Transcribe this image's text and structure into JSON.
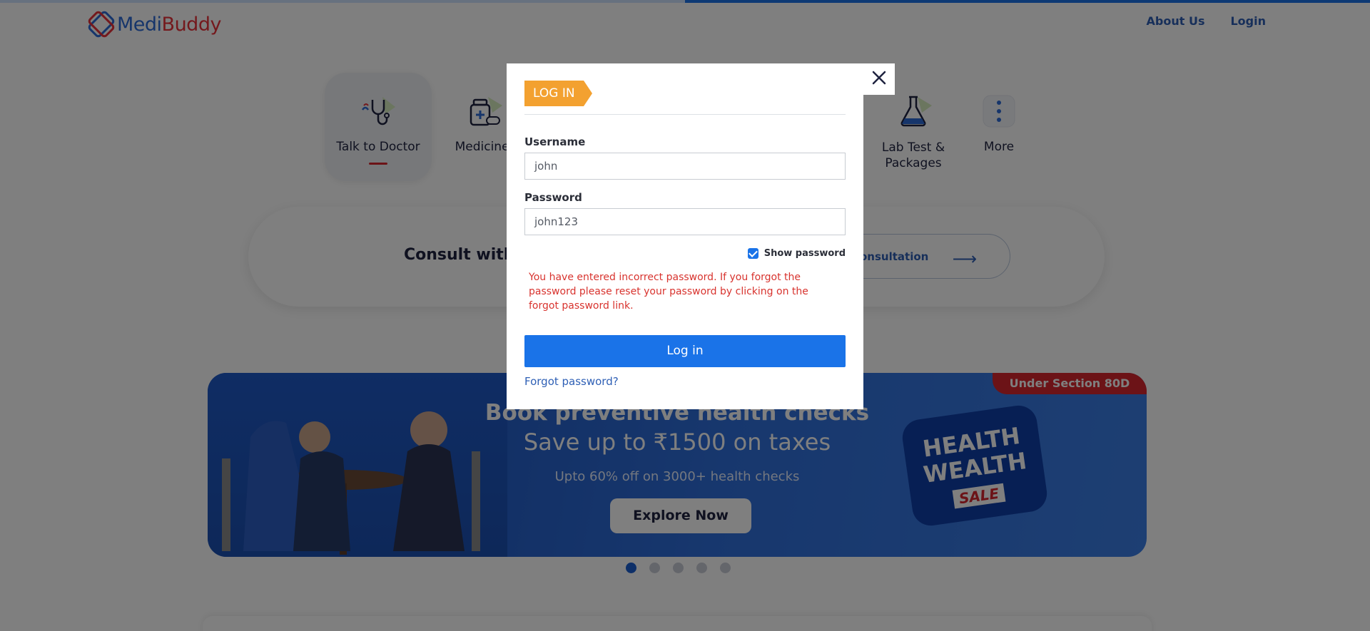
{
  "page": {
    "loading_progress": 0.5
  },
  "header": {
    "logo_part1": "Medi",
    "logo_part2": "Buddy",
    "nav": [
      {
        "label": "About Us"
      },
      {
        "label": "Login"
      }
    ]
  },
  "services": [
    {
      "label": "Talk to Doctor",
      "icon": "stethoscope-icon",
      "active": true
    },
    {
      "label": "Medicines",
      "icon": "medicine-bottle-icon",
      "active": false
    },
    {
      "label": "Lab Test & Packages",
      "icon": "flask-icon",
      "active": false
    },
    {
      "label": "More",
      "icon": "more-dots-icon",
      "active": false
    }
  ],
  "consult": {
    "text": "Consult with T",
    "button_label": "onsultation"
  },
  "banner": {
    "tag": "Under Section 80D",
    "title": "Book preventive health checks",
    "subtitle": "Save up to ₹1500 on taxes",
    "note": "Upto 60% off on 3000+ health checks",
    "cta": "Explore Now",
    "badge_line1": "HEALTH",
    "badge_line2": "WEALTH",
    "badge_sale": "SALE"
  },
  "carousel": {
    "count": 5,
    "active_index": 0
  },
  "modal": {
    "tag": "LOG IN",
    "username_label": "Username",
    "username_value": "john",
    "password_label": "Password",
    "password_value": "john123",
    "show_password_label": "Show password",
    "show_password_checked": true,
    "error": "You have entered incorrect password. If you forgot the password please reset your password by clicking on the forgot password link.",
    "submit_label": "Log in",
    "forgot_label": "Forgot password?"
  },
  "colors": {
    "brand_blue": "#2d6bd6",
    "brand_red": "#e8323a",
    "accent_orange": "#f3a130",
    "primary_button": "#1a73e8",
    "error_red": "#d8332e"
  }
}
